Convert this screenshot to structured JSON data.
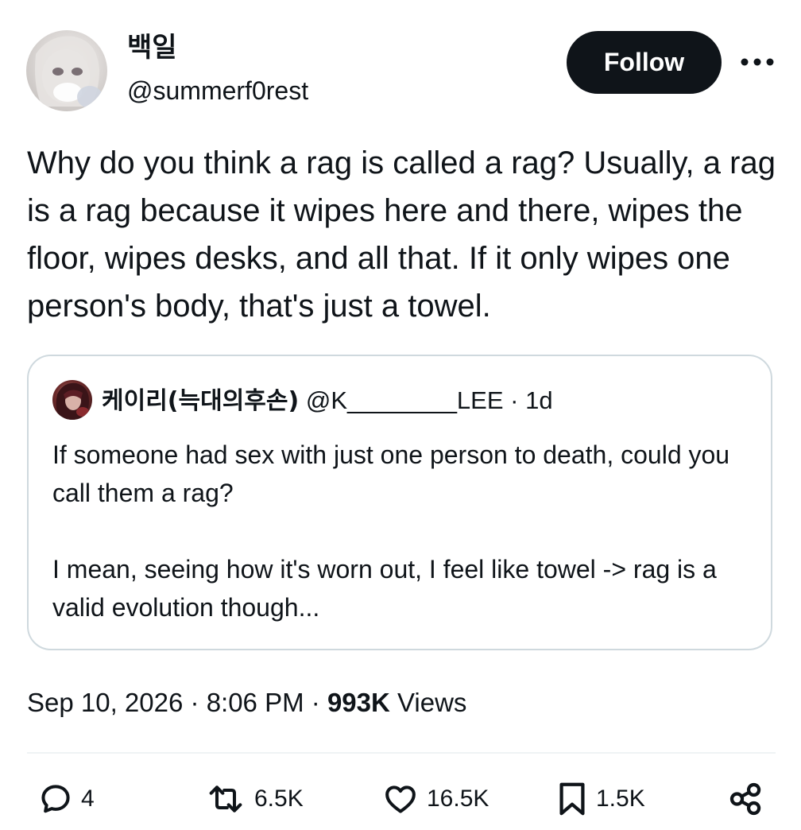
{
  "author": {
    "display_name": "백일",
    "handle": "@summerf0rest"
  },
  "follow_label": "Follow",
  "more_label": "•••",
  "tweet": {
    "text": "Why do you think a rag is called a rag? Usually, a rag is a rag because it wipes here and there, wipes the floor, wipes desks, and all that. If it only wipes one person's body, that's just a towel."
  },
  "quote": {
    "display_name": "케이리(늑대의후손)",
    "handle": "@K________LEE",
    "separator": "·",
    "age": "1d",
    "paragraph1": "If someone had sex with just one person to death, could you call them a rag?",
    "paragraph2": "I mean, seeing how it's worn out, I feel like towel -> rag is a valid evolution though..."
  },
  "meta": {
    "date": "Sep 10, 2026",
    "time": "8:06 PM",
    "separator": "·",
    "views_count": "993K",
    "views_label": "Views"
  },
  "actions": {
    "replies": "4",
    "reposts": "6.5K",
    "likes": "16.5K",
    "bookmarks": "1.5K"
  },
  "icons": {
    "reply": "reply-icon",
    "repost": "repost-icon",
    "like": "heart-icon",
    "bookmark": "bookmark-icon",
    "share": "share-icon",
    "more": "more-icon"
  }
}
